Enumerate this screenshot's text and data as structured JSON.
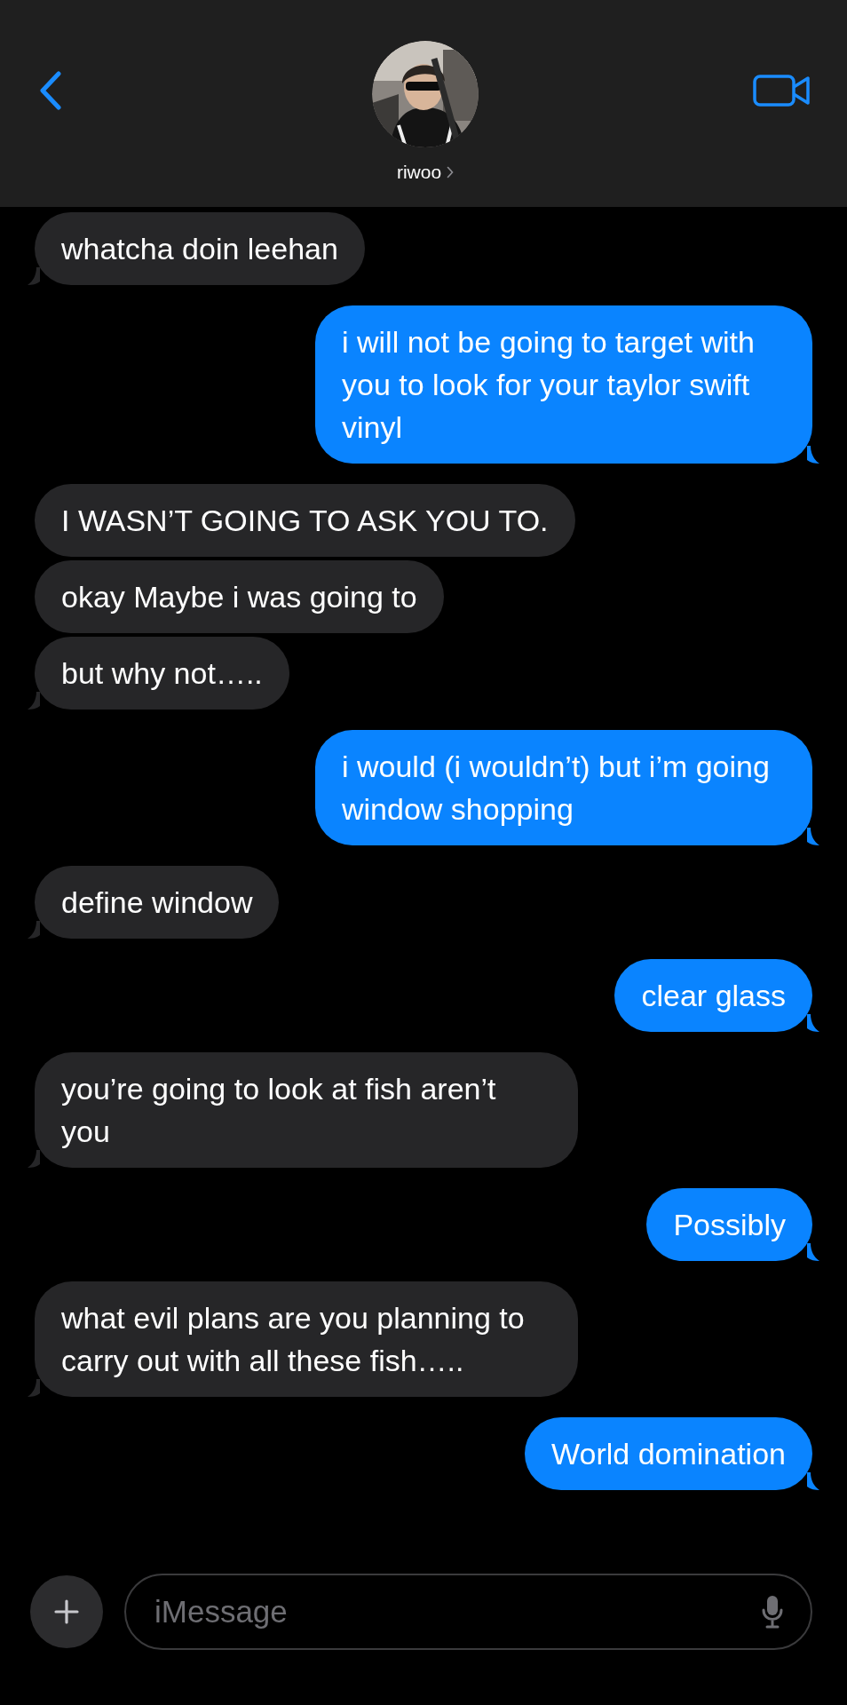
{
  "header": {
    "contact_name": "riwoo"
  },
  "messages": [
    {
      "kind": "incoming",
      "text": "whatcha doin leehan"
    },
    {
      "kind": "outgoing",
      "text": "i will not be going to target with you to look for your taylor swift vinyl"
    },
    {
      "kind": "incoming",
      "text": "I WASN’T GOING TO ASK YOU TO."
    },
    {
      "kind": "incoming",
      "text": "okay Maybe i was going to"
    },
    {
      "kind": "incoming",
      "text": "but why not….."
    },
    {
      "kind": "outgoing",
      "text": "i would (i wouldn’t) but i’m going window shopping"
    },
    {
      "kind": "incoming",
      "text": "define window"
    },
    {
      "kind": "outgoing",
      "text": "clear glass"
    },
    {
      "kind": "incoming",
      "text": "you’re going to look at fish aren’t you"
    },
    {
      "kind": "outgoing",
      "text": "Possibly"
    },
    {
      "kind": "incoming",
      "text": "what evil plans are you planning to carry out with all these fish….."
    },
    {
      "kind": "outgoing",
      "text": "World domination"
    }
  ],
  "composer": {
    "placeholder": "iMessage"
  }
}
